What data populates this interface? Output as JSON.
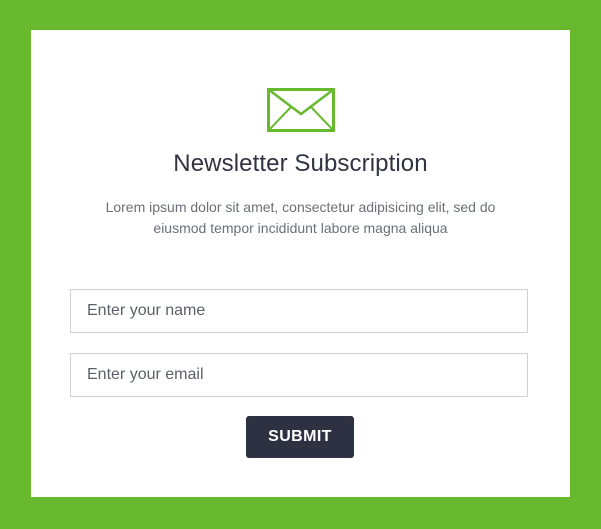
{
  "newsletter": {
    "icon": "envelope-icon",
    "title": "Newsletter Subscription",
    "description": "Lorem ipsum dolor sit amet, consectetur adipisicing elit, sed do eiusmod tempor incididunt labore magna aliqua",
    "name_placeholder": "Enter your name",
    "email_placeholder": "Enter your email",
    "submit_label": "SUBMIT"
  },
  "colors": {
    "background": "#68b92e",
    "accent": "#68b92e",
    "button": "#2d3142",
    "card": "#ffffff"
  }
}
